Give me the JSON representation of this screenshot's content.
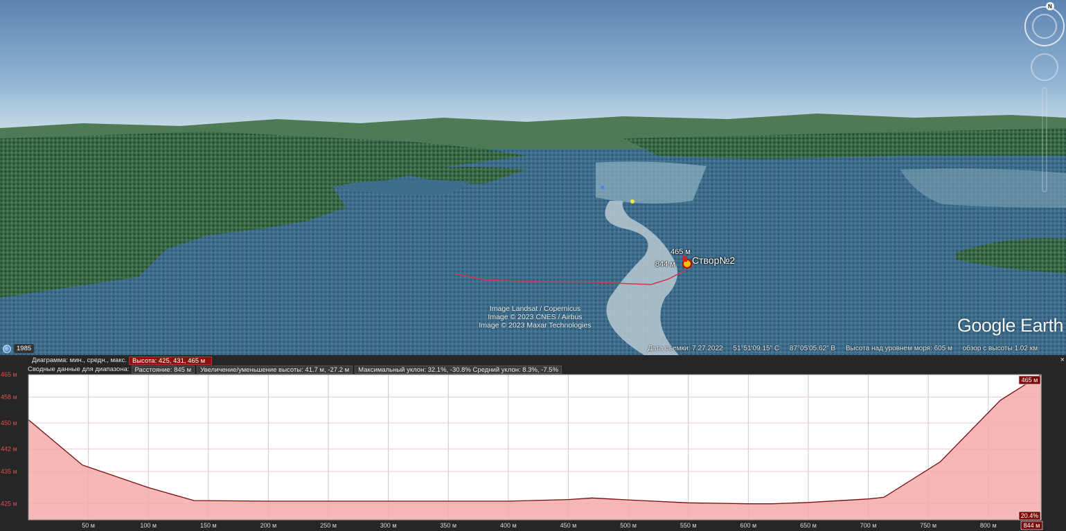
{
  "viewport": {
    "attribution": [
      "Image Landsat / Copernicus",
      "Image © 2023 CNES / Airbus",
      "Image © 2023 Maxar Technologies"
    ],
    "logo": "Google Earth",
    "year": "1985",
    "status": {
      "date": "Дата съемки: 7.27.2022",
      "lat": "51°51'09.15\" С",
      "lon": "87°05'05.62\" В",
      "elev": "Высота над уровнем моря:   605 м",
      "eye": "обзор с высоты   1.02 км"
    },
    "marker": {
      "title": "Створ№2",
      "height_label": "465 м",
      "distance_label": "844 м"
    },
    "compass_letter": "N"
  },
  "panel": {
    "row1_label": "Диаграмма: мин., средн., макс.",
    "row1_value": "Высота: 425, 431, 465 м",
    "row2_label": "Сводные данные для диапазона:",
    "row2_distance": "Расстояние: 845 м",
    "row2_gain": "Увеличение/уменьшение высоты: 41.7 м, -27.2 м",
    "row2_slope": "Максимальный уклон: 32.1%, -30.8% Средний уклон: 8.3%, -7.5%",
    "close_label": "×",
    "top_tag": "465 м",
    "slope_tag": "20.4%",
    "x_end_tag": "844 м"
  },
  "chart_data": {
    "type": "area",
    "xlabel": "",
    "ylabel": "",
    "xlim": [
      0,
      844
    ],
    "ylim": [
      420,
      465
    ],
    "y_ticks": [
      {
        "label": "465 м",
        "v": 465
      },
      {
        "label": "458 м",
        "v": 458
      },
      {
        "label": "450 м",
        "v": 450
      },
      {
        "label": "442 м",
        "v": 442
      },
      {
        "label": "435 м",
        "v": 435
      },
      {
        "label": "425 м",
        "v": 425
      }
    ],
    "x_ticks": [
      {
        "label": "50 м",
        "v": 50
      },
      {
        "label": "100 м",
        "v": 100
      },
      {
        "label": "150 м",
        "v": 150
      },
      {
        "label": "200 м",
        "v": 200
      },
      {
        "label": "250 м",
        "v": 250
      },
      {
        "label": "300 м",
        "v": 300
      },
      {
        "label": "350 м",
        "v": 350
      },
      {
        "label": "400 м",
        "v": 400
      },
      {
        "label": "450 м",
        "v": 450
      },
      {
        "label": "500 м",
        "v": 500
      },
      {
        "label": "550 м",
        "v": 550
      },
      {
        "label": "600 м",
        "v": 600
      },
      {
        "label": "650 м",
        "v": 650
      },
      {
        "label": "700 м",
        "v": 700
      },
      {
        "label": "750 м",
        "v": 750
      },
      {
        "label": "800 м",
        "v": 800
      }
    ],
    "series": [
      {
        "x": [
          0,
          45,
          100,
          138,
          200,
          300,
          400,
          450,
          470,
          500,
          550,
          600,
          620,
          650,
          700,
          713,
          760,
          810,
          844
        ],
        "values": [
          451,
          437,
          430,
          426,
          425.8,
          425.8,
          425.8,
          426.3,
          426.8,
          426.2,
          425.3,
          425,
          425,
          425.4,
          426.5,
          427,
          438,
          457,
          465
        ]
      }
    ],
    "grid": true,
    "colors": {
      "fill": "#f4aaaa",
      "line": "#7a0a0a",
      "bg": "#ffffff",
      "grid": "#c8c8c8"
    }
  }
}
